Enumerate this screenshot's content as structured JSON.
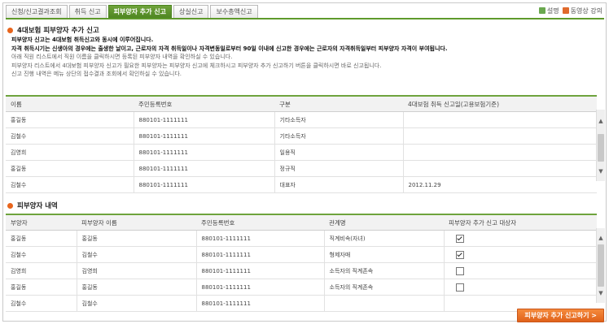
{
  "tabs": [
    "신청/신고결과조회",
    "취득 신고",
    "피부양자 추가 신고",
    "상실신고",
    "보수총액신고"
  ],
  "active_tab": 2,
  "toplinks": {
    "help": "설명",
    "video": "동영상 강의"
  },
  "section1": {
    "title": "4대보험 피부양자 추가 신고",
    "lines": [
      "피부양자 신고는 4대보험 취득신고와 동시에 이루어집니다.",
      "자격 취득시기는 신생아의 경우에는 출생한 날이고, 근로자의 자격 취득일이나 자격변동일로부터 90일 이내에 신고한 경우에는 근로자의 자격취득일부터 피부양자 자격이 부여됩니다.",
      "아래 직원 리스트에서 직원 이름을 클릭하시면 등록된 피부양자 내역을 확인하실 수 있습니다.",
      "피부양자 리스트에서 4대보험 피부양자 신고가 필요한 피부양자는 피부양자 신고에 체크하시고 피부양자 추가 신고하기 버튼을 클릭하시면 바로 신고됩니다.",
      "신고 진행 내역은 메뉴 상단의 접수결과 조회에서 확인하실 수 있습니다."
    ]
  },
  "table1": {
    "headers": [
      "이름",
      "주민등록번호",
      "구분",
      "4대보험 취득 신고일(고용보험기준)"
    ],
    "rows": [
      [
        "홍길동",
        "880101-1111111",
        "기타소득자",
        ""
      ],
      [
        "김철수",
        "880101-1111111",
        "기타소득자",
        ""
      ],
      [
        "김영희",
        "880101-1111111",
        "일용직",
        ""
      ],
      [
        "홍길동",
        "880101-1111111",
        "정규직",
        ""
      ],
      [
        "김철수",
        "880101-1111111",
        "대표자",
        "2012.11.29"
      ]
    ]
  },
  "section2": {
    "title": "피부양자 내역"
  },
  "table2": {
    "headers": [
      "부양자",
      "피부양자 이름",
      "주민등록번호",
      "관계명",
      "피부양자 추가 신고 대상자"
    ],
    "rows": [
      [
        "홍길동",
        "홍길동",
        "880101-1111111",
        "직계비속(자녀)"
      ],
      [
        "김철수",
        "김철수",
        "880101-1111111",
        "형제자매"
      ],
      [
        "김영희",
        "김영희",
        "880101-1111111",
        "소득자의 직계존속"
      ],
      [
        "홍길동",
        "홍길동",
        "880101-1111111",
        "소득자의 직계존속"
      ],
      [
        "김철수",
        "김철수",
        "880101-1111111",
        ""
      ]
    ],
    "checked": [
      true,
      true,
      false,
      false
    ]
  },
  "button": {
    "label": "피부양자 추가 신고하기 >"
  }
}
